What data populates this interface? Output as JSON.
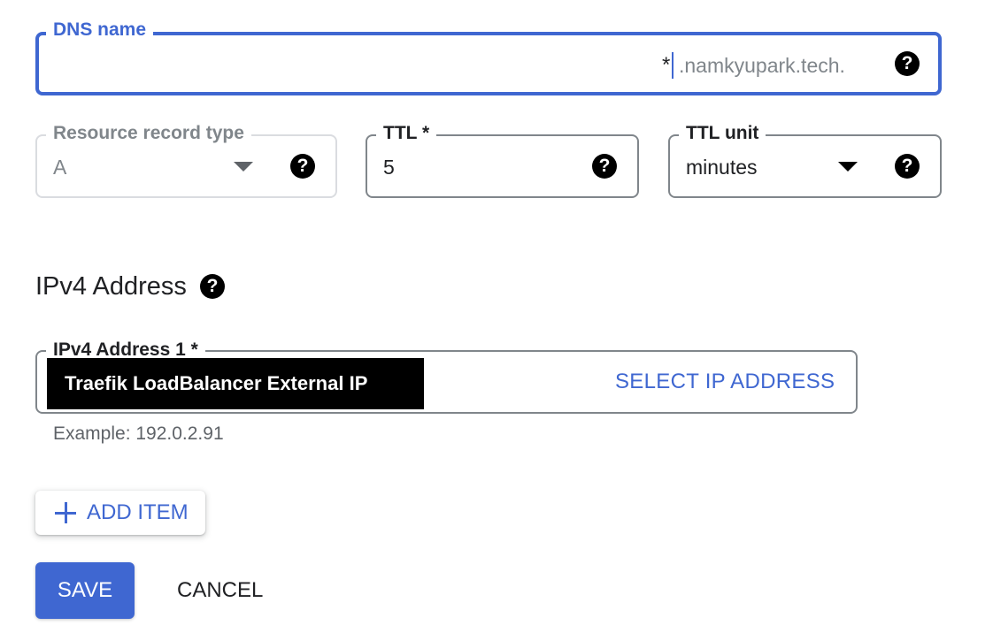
{
  "dns_name": {
    "label": "DNS name",
    "value": "*",
    "suffix": ".namkyupark.tech.",
    "help_icon": "help-icon"
  },
  "resource_record_type": {
    "label": "Resource record type",
    "value": "A",
    "disabled": true,
    "help_icon": "help-icon"
  },
  "ttl": {
    "label": "TTL *",
    "value": "5",
    "help_icon": "help-icon"
  },
  "ttl_unit": {
    "label": "TTL unit",
    "value": "minutes",
    "help_icon": "help-icon"
  },
  "ipv4_section": {
    "title": "IPv4 Address",
    "help_icon": "help-icon"
  },
  "ipv4_address_1": {
    "label": "IPv4 Address 1 *",
    "value": "Traefik LoadBalancer External IP",
    "select_button": "SELECT IP ADDRESS",
    "hint": "Example: 192.0.2.91"
  },
  "add_item": {
    "label": "ADD ITEM",
    "icon": "plus-icon"
  },
  "actions": {
    "save": "SAVE",
    "cancel": "CANCEL"
  },
  "colors": {
    "accent": "#3f67d1",
    "border": "#80868b",
    "disabled_border": "#dadce0",
    "text": "#202124",
    "muted_text": "#80868b"
  }
}
